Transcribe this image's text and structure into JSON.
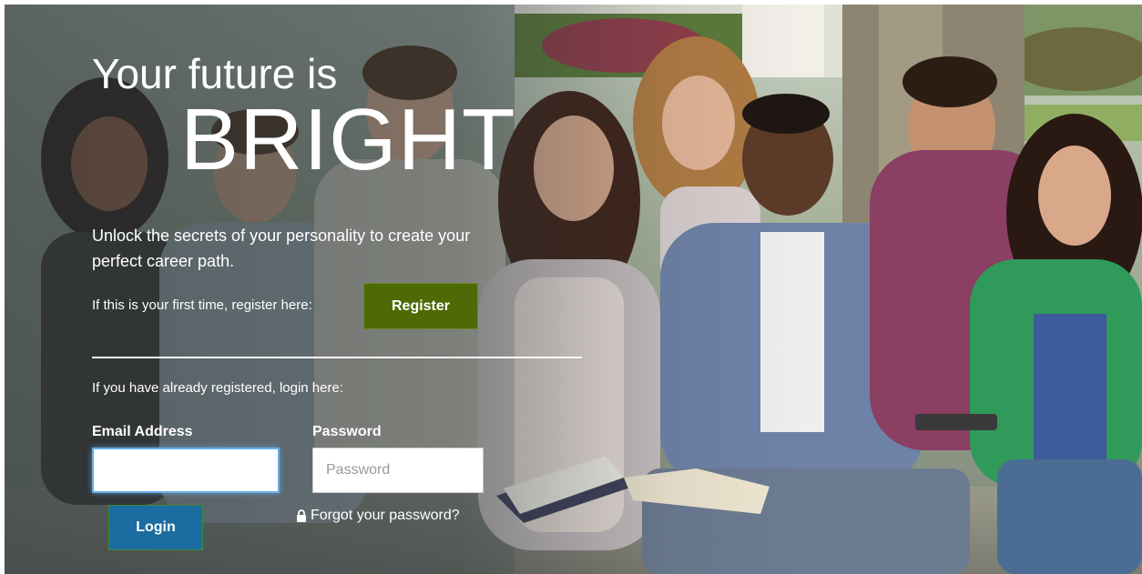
{
  "hero": {
    "heading_line1": "Your future is",
    "heading_line2": "BRIGHT",
    "tagline": "Unlock the secrets of your personality to create your perfect career path."
  },
  "register": {
    "prompt": "If this is your first time, register here:",
    "button_label": "Register"
  },
  "login": {
    "prompt": "If you have already registered, login here:",
    "email_label": "Email Address",
    "email_value": "",
    "email_placeholder": "",
    "password_label": "Password",
    "password_placeholder": "Password",
    "button_label": "Login",
    "forgot_label": "Forgot your password?",
    "forgot_icon": "lock-icon"
  },
  "colors": {
    "register_button": "#4d6a07",
    "login_button": "#1b6ca0",
    "focus_border": "#66afe9"
  }
}
